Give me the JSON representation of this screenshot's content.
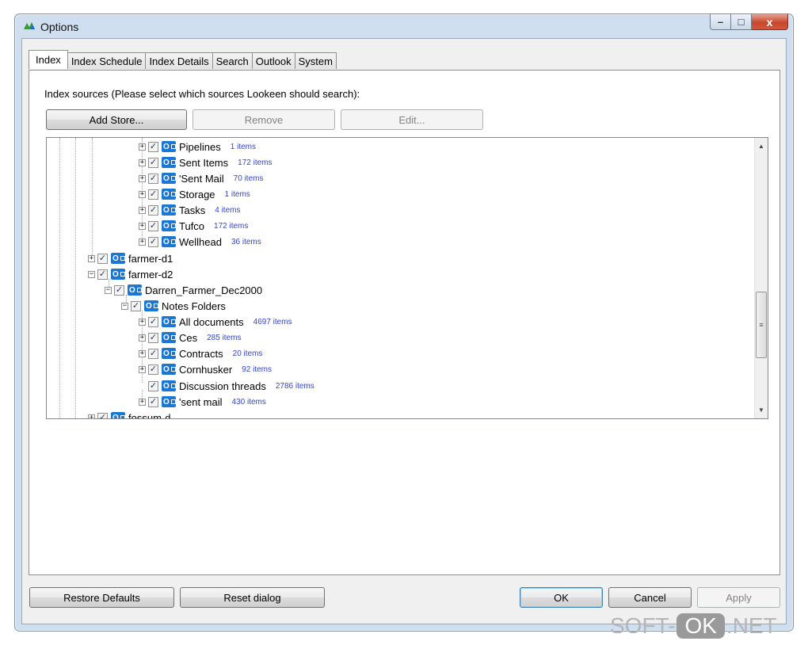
{
  "window": {
    "title": "Options",
    "controls": {
      "minimize": "–",
      "maximize": "□",
      "close": "x"
    }
  },
  "tabs": [
    {
      "label": "Index",
      "active": true
    },
    {
      "label": "Index Schedule"
    },
    {
      "label": "Index Details"
    },
    {
      "label": "Search"
    },
    {
      "label": "Outlook"
    },
    {
      "label": "System"
    }
  ],
  "index": {
    "sources_label": "Index sources (Please select which sources Lookeen should search):",
    "add_store_label": "Add Store...",
    "remove_label": "Remove",
    "edit_label": "Edit..."
  },
  "tree": {
    "items": [
      {
        "label": "Pipelines",
        "count": "1 items",
        "expander": "+"
      },
      {
        "label": "Sent Items",
        "count": "172 items",
        "expander": "+"
      },
      {
        "label": "'Sent Mail",
        "count": "70 items",
        "expander": "+"
      },
      {
        "label": "Storage",
        "count": "1 items",
        "expander": "+"
      },
      {
        "label": "Tasks",
        "count": "4 items",
        "expander": "+"
      },
      {
        "label": "Tufco",
        "count": "172 items",
        "expander": "+"
      },
      {
        "label": "Wellhead",
        "count": "36 items",
        "expander": "+"
      },
      {
        "label": "farmer-d1",
        "count": "",
        "expander": "+"
      },
      {
        "label": "farmer-d2",
        "count": "",
        "expander": "−"
      },
      {
        "label": "Darren_Farmer_Dec2000",
        "count": "",
        "expander": "−"
      },
      {
        "label": "Notes Folders",
        "count": "",
        "expander": "−"
      },
      {
        "label": "All documents",
        "count": "4697 items",
        "expander": "+"
      },
      {
        "label": "Ces",
        "count": "285 items",
        "expander": "+"
      },
      {
        "label": "Contracts",
        "count": "20 items",
        "expander": "+"
      },
      {
        "label": "Cornhusker",
        "count": "92 items",
        "expander": "+"
      },
      {
        "label": "Discussion threads",
        "count": "2786 items",
        "expander": ""
      },
      {
        "label": "'sent mail",
        "count": "430 items",
        "expander": "+"
      },
      {
        "label": "fossum-d",
        "count": "",
        "expander": "+"
      }
    ],
    "check_mark": "✓",
    "icon_letter": "O"
  },
  "footer": {
    "restore_defaults_label": "Restore Defaults",
    "reset_dialog_label": "Reset dialog",
    "ok_label": "OK",
    "cancel_label": "Cancel",
    "apply_label": "Apply"
  },
  "watermark": {
    "left": "SOFT-",
    "ok": "OK",
    "right": ".NET"
  }
}
